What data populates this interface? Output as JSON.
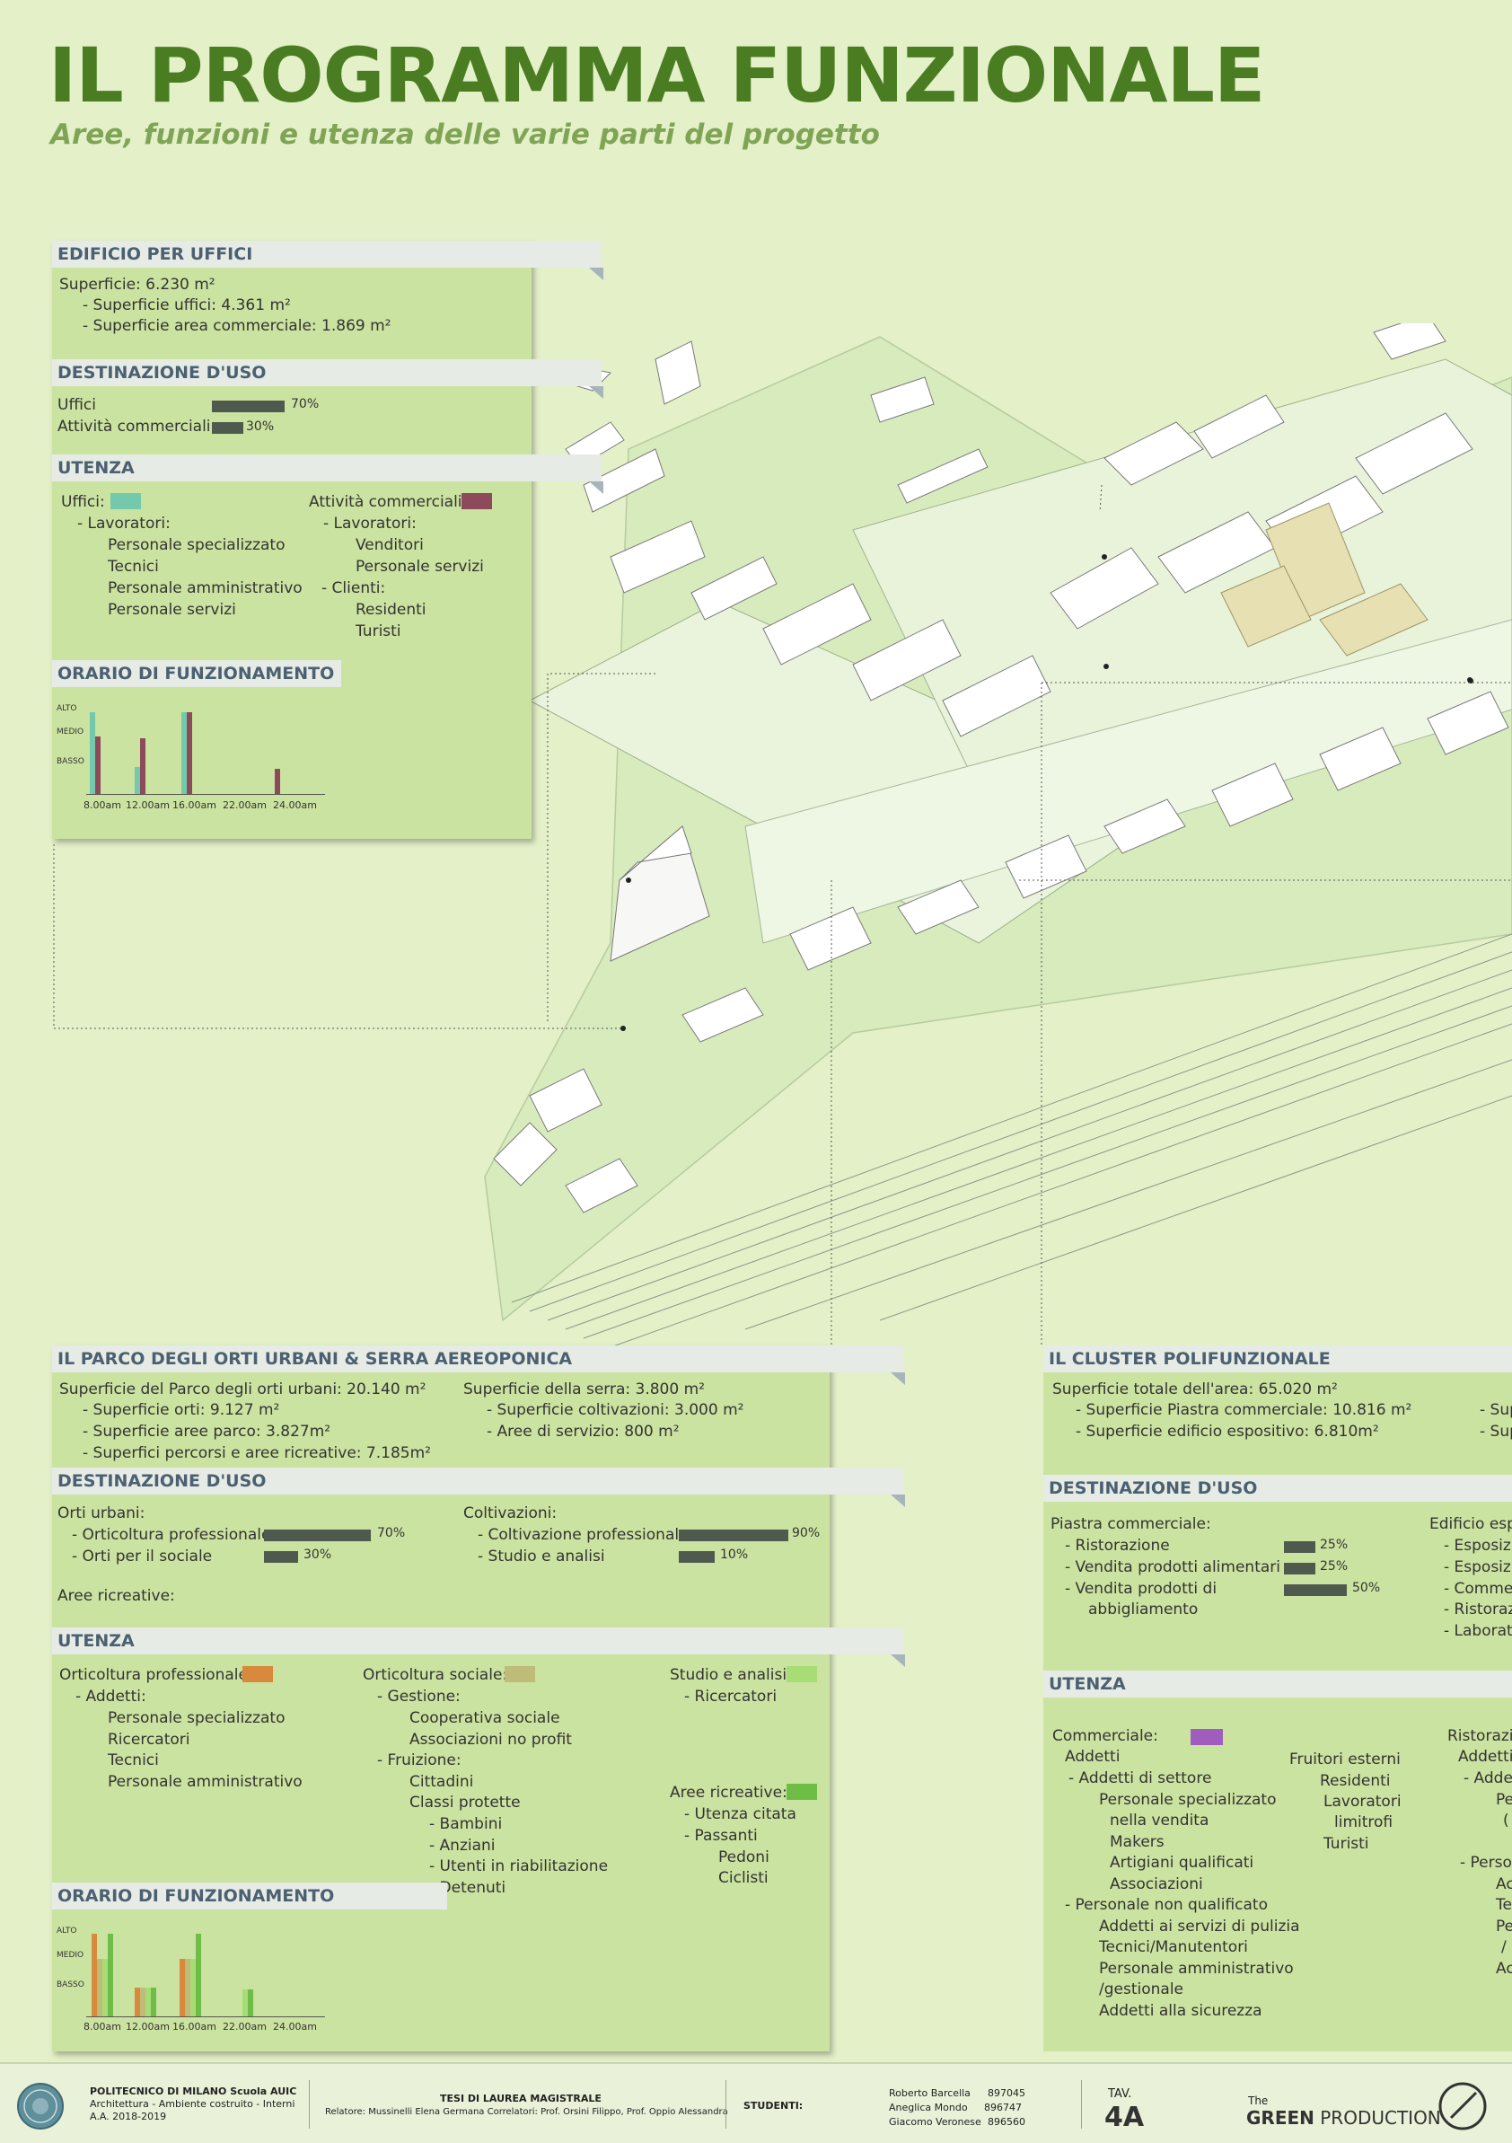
{
  "title": "IL PROGRAMMA FUNZIONALE",
  "subtitle": "Aree, funzioni e utenza delle varie parti del progetto",
  "colors": {
    "title": "#4a7c22",
    "panel": "#cbe3a0",
    "header": "#e6ebe6",
    "bar": "#4f5a4e",
    "teal": "#74c9ad",
    "maroon": "#8c4a5a",
    "orange": "#d9893c",
    "khaki": "#bfbc7a",
    "lightgreen": "#a8dd76",
    "green": "#6dbd46",
    "purple": "#a15dbd"
  },
  "uffici": {
    "h1": "EDIFICIO PER UFFICI",
    "sup": "Superficie: 6.230 m²",
    "sup1": "- Superficie uffici: 4.361 m²",
    "sup2": "- Superficie area commerciale: 1.869 m²",
    "h2": "DESTINAZIONE D'USO",
    "use": [
      {
        "label": "Uffici",
        "pct": "70%",
        "value": 70
      },
      {
        "label": "Attività commerciali",
        "pct": "30%",
        "value": 30
      }
    ],
    "h3": "UTENZA",
    "col1": {
      "title": "Uffici:",
      "l1": "- Lavoratori:",
      "items": [
        "Personale specializzato",
        "Tecnici",
        "Personale amministrativo",
        "Personale servizi"
      ]
    },
    "col2": {
      "title": "Attività commerciali:",
      "l1": "- Lavoratori:",
      "items1": [
        "Venditori",
        "Personale servizi"
      ],
      "l2": "- Clienti:",
      "items2": [
        "Residenti",
        "Turisti"
      ]
    },
    "h4": "ORARIO DI FUNZIONAMENTO",
    "levels": [
      "ALTO",
      "MEDIO",
      "BASSO"
    ],
    "times": [
      "8.00am",
      "12.00am",
      "16.00am",
      "22.00am",
      "24.00am"
    ]
  },
  "parco": {
    "h1": "IL PARCO DEGLI ORTI URBANI & SERRA AEREOPONICA",
    "sup": "Superficie del Parco degli orti urbani: 20.140 m²",
    "sup1": "- Superficie orti: 9.127 m²",
    "sup2": "- Superficie aree parco: 3.827m²",
    "sup3": "- Superfici percorsi e aree ricreative: 7.185m²",
    "serra": "Superficie della serra: 3.800 m²",
    "serra1": "- Superficie coltivazioni: 3.000 m²",
    "serra2": "- Aree di servizio: 800 m²",
    "h2": "DESTINAZIONE D'USO",
    "orti": {
      "title": "Orti urbani:",
      "items": [
        {
          "label": "- Orticoltura professionale",
          "pct": "70%",
          "value": 70
        },
        {
          "label": "- Orti per il sociale",
          "pct": "30%",
          "value": 30
        }
      ]
    },
    "colt": {
      "title": "Coltivazioni:",
      "items": [
        {
          "label": "- Coltivazione professionale",
          "pct": "90%",
          "value": 90
        },
        {
          "label": "- Studio e analisi",
          "pct": "10%",
          "value": 10
        }
      ]
    },
    "aree": "Aree ricreative:",
    "h3": "UTENZA",
    "c1": {
      "title": "Orticoltura professionale:",
      "l1": "- Addetti:",
      "items": [
        "Personale specializzato",
        "Ricercatori",
        "Tecnici",
        "Personale amministrativo"
      ]
    },
    "c2": {
      "title": "Orticoltura sociale:",
      "l1": "- Gestione:",
      "items1": [
        "Cooperativa sociale",
        "Associazioni no profit"
      ],
      "l2": "- Fruizione:",
      "items2": [
        "Cittadini",
        "Classi protette"
      ],
      "items3": [
        "- Bambini",
        "- Anziani",
        "- Utenti in riabilitazione",
        "- Detenuti"
      ]
    },
    "c3": {
      "title": "Studio e analisi:",
      "l1": "- Ricercatori"
    },
    "c4": {
      "title": "Aree ricreative:",
      "l1": "- Utenza citata",
      "l2": "- Passanti",
      "items": [
        "Pedoni",
        "Ciclisti"
      ]
    },
    "h4": "ORARIO DI FUNZIONAMENTO",
    "levels": [
      "ALTO",
      "MEDIO",
      "BASSO"
    ],
    "times": [
      "8.00am",
      "12.00am",
      "16.00am",
      "22.00am",
      "24.00am"
    ]
  },
  "cluster": {
    "h1": "IL CLUSTER POLIFUNZIONALE",
    "sup": "Superficie totale dell'area: 65.020 m²",
    "sup1": "- Superficie Piastra commerciale: 10.816 m²",
    "sup2": "- Superficie edificio espositivo: 6.810m²",
    "sup_r1": "- Sup",
    "sup_r2": "- Sup",
    "h2": "DESTINAZIONE D'USO",
    "piastra": {
      "title": "Piastra commerciale:",
      "items": [
        {
          "label": "- Ristorazione",
          "pct": "25%",
          "value": 25
        },
        {
          "label": "- Vendita prodotti alimentari",
          "pct": "25%",
          "value": 25
        },
        {
          "label": "- Vendita prodotti di",
          "pct": "50%",
          "value": 50
        }
      ],
      "cont": "abbigliamento"
    },
    "edif": {
      "title": "Edificio espo",
      "items": [
        "- Esposizi",
        "- Esposizi",
        "- Comme",
        "- Ristoraz",
        "- Laborato"
      ]
    },
    "h3": "UTENZA",
    "comm": {
      "title": "Commerciale:",
      "l1": "Addetti",
      "l2": "- Addetti di settore",
      "items": [
        "Personale specializzato",
        "nella vendita",
        "Makers",
        "Artigiani qualificati",
        "Associazioni"
      ],
      "l3": "- Personale non qualificato",
      "items2": [
        "Addetti ai servizi di pulizia",
        "Tecnici/Manutentori",
        "Personale amministrativo",
        "/gestionale",
        "Addetti alla sicurezza"
      ]
    },
    "fruit": {
      "title": "Fruitori esterni",
      "items": [
        "Residenti",
        "Lavoratori",
        "limitrofi",
        "Turisti"
      ]
    },
    "rist": {
      "title": "Ristorazio",
      "l1": "Addetti",
      "l2": "- Adde",
      "items": [
        "Pe",
        "(",
        "- Perso",
        "Ac",
        "Tec",
        "Pe",
        "/",
        "Ac"
      ]
    }
  },
  "footer": {
    "uni": "POLITECNICO DI MILANO",
    "school": "Scuola AUIC",
    "course": "Architettura - Ambiente costruito - Interni",
    "year": "A.A. 2018-2019",
    "thesis": "TESI DI LAUREA MAGISTRALE",
    "relatore": "Relatore: Mussinelli Elena Germana Correlatori: Prof. Orsini Filippo, Prof. Oppio Alessandra",
    "studenti": "STUDENTI:",
    "students": [
      {
        "name": "Roberto Barcella",
        "id": "897045"
      },
      {
        "name": "Aneglica Mondo",
        "id": "896747"
      },
      {
        "name": "Giacomo Veronese",
        "id": "896560"
      }
    ],
    "tav": "TAV.",
    "tav_num": "4A",
    "brand_the": "The",
    "brand_green": "GREEN",
    "brand_prod": "PRODUCTION"
  }
}
